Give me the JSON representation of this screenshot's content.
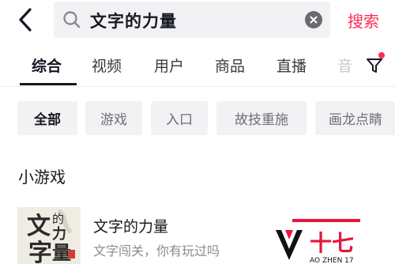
{
  "search": {
    "query": "文字的力量",
    "submit_label": "搜索"
  },
  "tabs": [
    {
      "label": "综合",
      "active": true
    },
    {
      "label": "视频"
    },
    {
      "label": "用户"
    },
    {
      "label": "商品"
    },
    {
      "label": "直播"
    },
    {
      "label": "音"
    }
  ],
  "chips": [
    {
      "label": "全部",
      "active": true
    },
    {
      "label": "游戏"
    },
    {
      "label": "入口"
    },
    {
      "label": "故技重施"
    },
    {
      "label": "画龙点睛"
    }
  ],
  "section": {
    "title": "小游戏"
  },
  "result": {
    "title": "文字的力量",
    "description": "文字闯关，你有玩过吗",
    "thumbnail_text": [
      "文",
      "的",
      "力",
      "字",
      "量"
    ]
  },
  "watermark": {
    "main": "十七",
    "sub": "AO ZHEN 17"
  },
  "colors": {
    "accent": "#fe2c55",
    "text": "#161823",
    "muted": "#8a8b91",
    "chip_bg": "#f2f2f4"
  },
  "icons": {
    "back": "back-chevron-icon",
    "search": "search-icon",
    "clear": "clear-icon",
    "filter": "filter-icon"
  }
}
